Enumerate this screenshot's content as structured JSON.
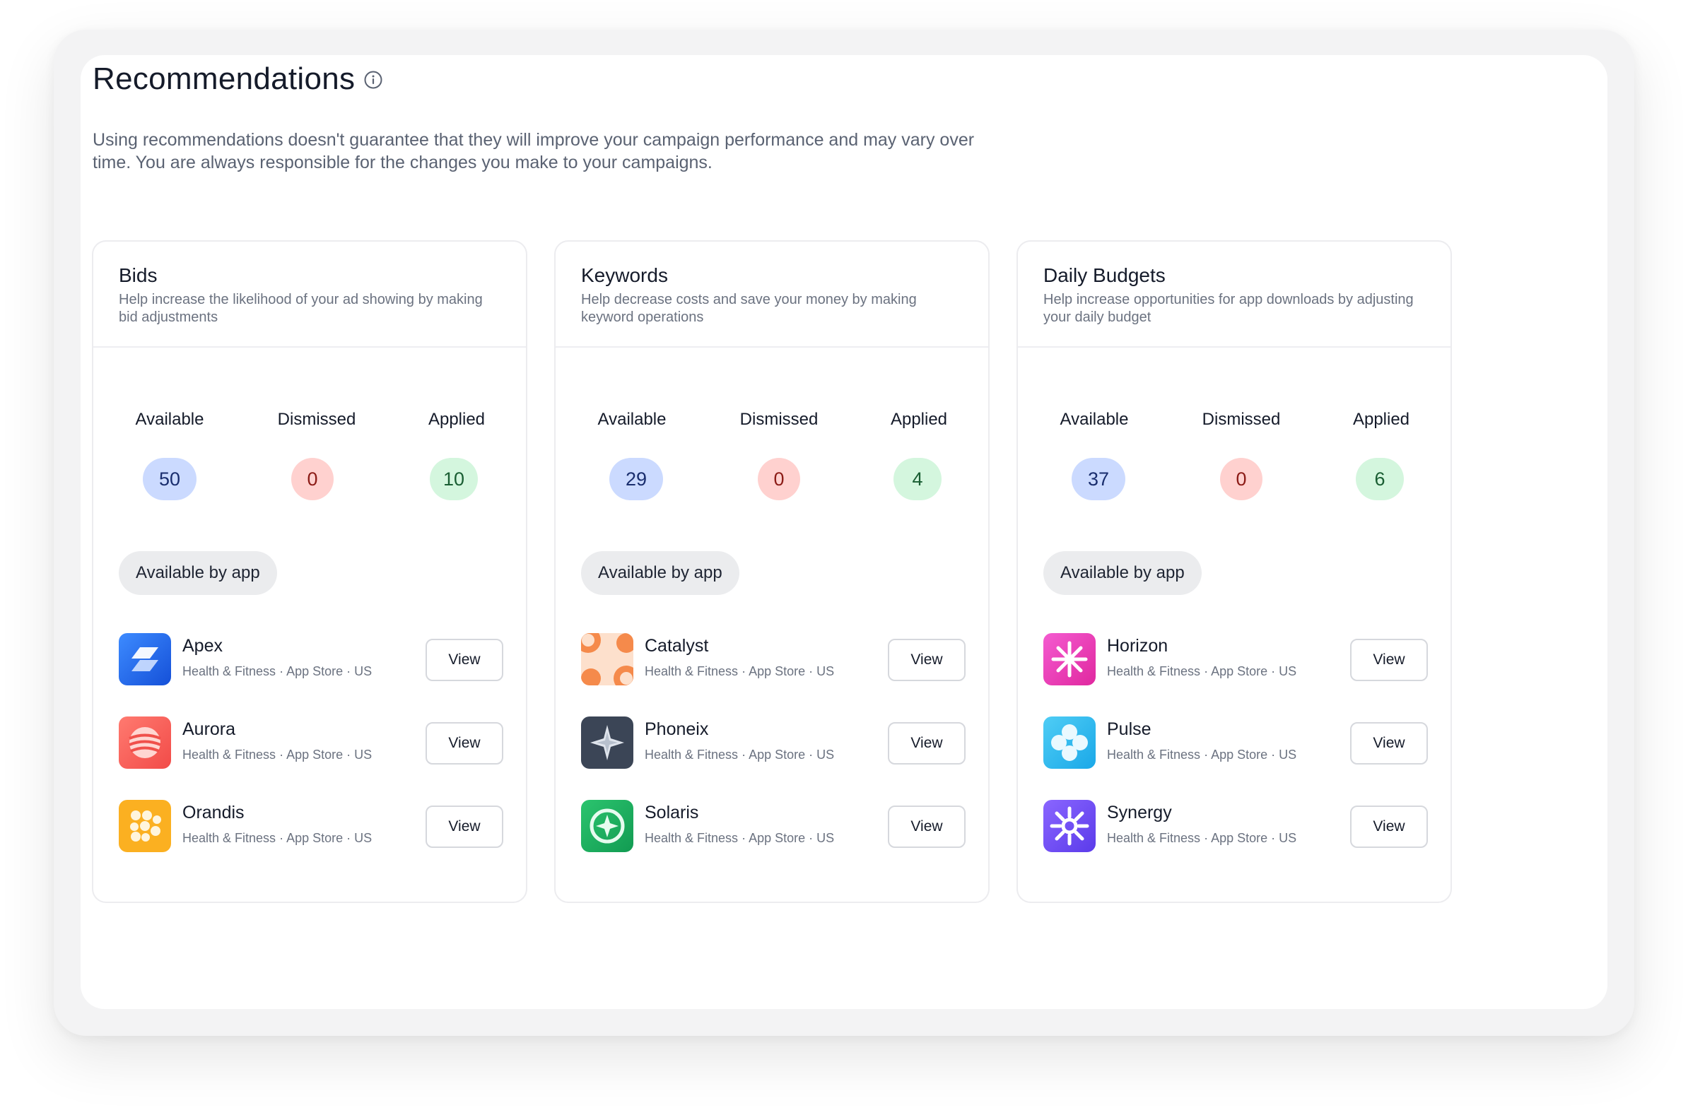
{
  "page": {
    "title": "Recommendations",
    "info_icon": "info-circle-icon",
    "subtitle": "Using recommendations doesn't guarantee that they will improve your campaign performance and may vary over time. You are always responsible for the changes you make to your campaigns."
  },
  "colors": {
    "available": "#cbdaff",
    "dismissed": "#ffd1cf",
    "applied": "#d4f6de"
  },
  "cards": [
    {
      "title": "Bids",
      "description": "Help increase the likelihood of your ad showing by making bid adjustments",
      "stats": {
        "available_label": "Available",
        "available": "50",
        "dismissed_label": "Dismissed",
        "dismissed": "0",
        "applied_label": "Applied",
        "applied": "10"
      },
      "chip": "Available by app",
      "apps": [
        {
          "name": "Apex",
          "category": "Health & Fitness",
          "store": "App Store",
          "country": "US",
          "icon": "apex-logo-icon",
          "action": "View"
        },
        {
          "name": "Aurora",
          "category": "Health & Fitness",
          "store": "App Store",
          "country": "US",
          "icon": "aurora-logo-icon",
          "action": "View"
        },
        {
          "name": "Orandis",
          "category": "Health & Fitness",
          "store": "App Store",
          "country": "US",
          "icon": "orandis-logo-icon",
          "action": "View"
        }
      ]
    },
    {
      "title": "Keywords",
      "description": "Help decrease costs and save your money by making keyword operations",
      "stats": {
        "available_label": "Available",
        "available": "29",
        "dismissed_label": "Dismissed",
        "dismissed": "0",
        "applied_label": "Applied",
        "applied": "4"
      },
      "chip": "Available by app",
      "apps": [
        {
          "name": "Catalyst",
          "category": "Health & Fitness",
          "store": "App Store",
          "country": "US",
          "icon": "catalyst-logo-icon",
          "action": "View"
        },
        {
          "name": "Phoneix",
          "category": "Health & Fitness",
          "store": "App Store",
          "country": "US",
          "icon": "phoneix-logo-icon",
          "action": "View"
        },
        {
          "name": "Solaris",
          "category": "Health & Fitness",
          "store": "App Store",
          "country": "US",
          "icon": "solaris-logo-icon",
          "action": "View"
        }
      ]
    },
    {
      "title": "Daily Budgets",
      "description": "Help increase opportunities for app downloads by adjusting your daily budget",
      "stats": {
        "available_label": "Available",
        "available": "37",
        "dismissed_label": "Dismissed",
        "dismissed": "0",
        "applied_label": "Applied",
        "applied": "6"
      },
      "chip": "Available by app",
      "apps": [
        {
          "name": "Horizon",
          "category": "Health & Fitness",
          "store": "App Store",
          "country": "US",
          "icon": "horizon-logo-icon",
          "action": "View"
        },
        {
          "name": "Pulse",
          "category": "Health & Fitness",
          "store": "App Store",
          "country": "US",
          "icon": "pulse-logo-icon",
          "action": "View"
        },
        {
          "name": "Synergy",
          "category": "Health & Fitness",
          "store": "App Store",
          "country": "US",
          "icon": "synergy-logo-icon",
          "action": "View"
        }
      ]
    }
  ]
}
